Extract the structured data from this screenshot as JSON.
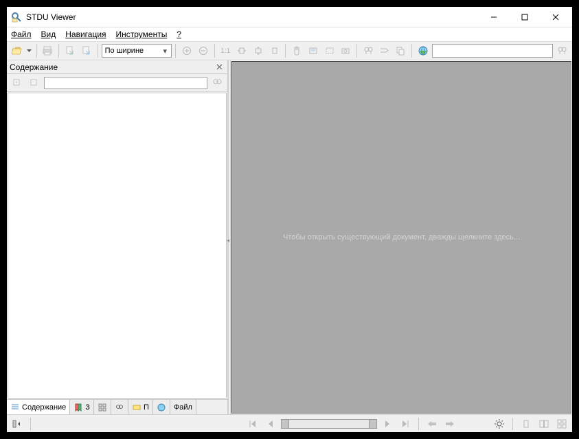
{
  "window": {
    "title": "STDU Viewer"
  },
  "menu": {
    "file": "Файл",
    "view": "Вид",
    "nav": "Навигация",
    "tools": "Инструменты",
    "help": "?"
  },
  "toolbar": {
    "zoom_mode": "По ширине"
  },
  "sidebar": {
    "title": "Содержание",
    "tabs": {
      "contents": "Содержание",
      "bookmarks": "З",
      "search": "П",
      "files": "Файл",
      "thumbs": "П"
    }
  },
  "main": {
    "hint": "Чтобы открыть существующий документ, дважды щелкните здесь..."
  }
}
